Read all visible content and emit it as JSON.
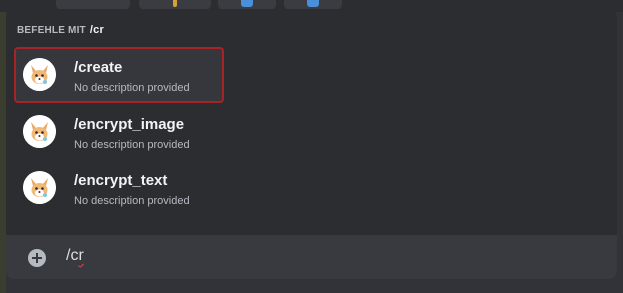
{
  "autocomplete": {
    "header_label": "BEFEHLE MIT",
    "header_query": "/cr",
    "commands": [
      {
        "name": "/create",
        "description": "No description provided",
        "selected": true,
        "avatar_icon": "fox-avatar-icon"
      },
      {
        "name": "/encrypt_image",
        "description": "No description provided",
        "selected": false,
        "avatar_icon": "fox-avatar-icon"
      },
      {
        "name": "/encrypt_text",
        "description": "No description provided",
        "selected": false,
        "avatar_icon": "fox-avatar-icon"
      }
    ]
  },
  "message_input": {
    "value_prefix": "/c",
    "value_underlined": "r",
    "add_icon": "plus-circle-icon"
  },
  "colors": {
    "popup_bg": "#2b2d31",
    "input_bg": "#383a40",
    "selection_outline": "#a72328",
    "command_name": "#f2f3f5",
    "command_desc": "#b5bac1"
  }
}
